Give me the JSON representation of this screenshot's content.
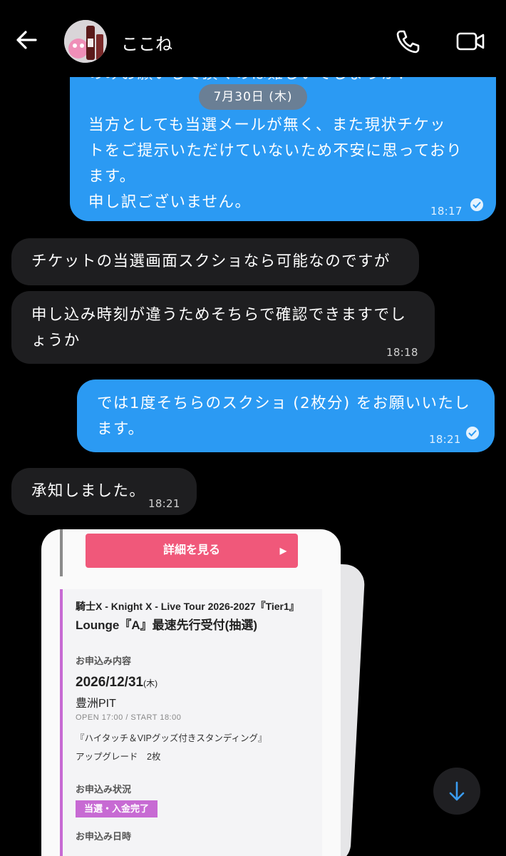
{
  "header": {
    "contact_name": "ここね",
    "icons": {
      "back": "arrow-left-icon",
      "phone": "phone-icon",
      "video": "video-camera-icon"
    }
  },
  "date_separator": "7月30日 (木)",
  "messages": [
    {
      "direction": "outgoing",
      "lines": [
        "のみお願いして頂くのは難しいでしょうか？",
        "当方としても当選メールが無く、また現状チケッ",
        "トをご提示いただけていないため不安に思っており",
        "ます。",
        "申し訳ございません。"
      ],
      "time": "18:17",
      "read": true
    },
    {
      "direction": "incoming",
      "lines": [
        "チケットの当選画面スクショなら可能なのですが"
      ],
      "time": ""
    },
    {
      "direction": "incoming",
      "lines": [
        "申し込み時刻が違うためそちらで確認できますでし",
        "ょうか"
      ],
      "time": "18:18"
    },
    {
      "direction": "outgoing",
      "lines": [
        "では1度そちらのスクショ (2枚分) をお願いいたし",
        "ます。"
      ],
      "time": "18:21",
      "read": true
    },
    {
      "direction": "incoming",
      "lines": [
        "承知しました。"
      ],
      "time": "18:21"
    }
  ],
  "screenshot": {
    "detail_button": "詳細を見る",
    "tour_title": "騎士X - Knight X - Live Tour 2026-2027『Tier1』",
    "ticket_type": "Lounge『A』最速先行受付(抽選)",
    "application_label": "お申込み内容",
    "event_date": "2026/12/31",
    "event_weekday": "(木)",
    "venue": "豊洲PIT",
    "open_start": "OPEN 17:00 / START 18:00",
    "seat_type": "『ハイタッチ＆VIPグッズ付きスタンディング』",
    "upgrade": "アップグレード　2枚",
    "status_label": "お申込み状況",
    "status": "当選・入金完了",
    "apply_datetime_label": "お申込み日時"
  },
  "colors": {
    "outgoing_bubble": "#2b9af3",
    "incoming_bubble": "#1e1e20",
    "date_pill": "#6a7f95",
    "detail_button": "#f0587a",
    "status_badge": "#c76ad3"
  },
  "scroll_down_icon": "arrow-down-icon"
}
